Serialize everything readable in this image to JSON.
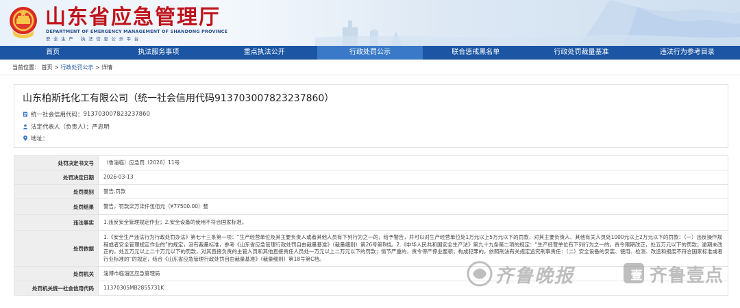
{
  "header": {
    "title": "山东省应急管理厅",
    "title_en": "DEPARTMENT OF EMERGENCY MANAGEMENT OF SHANDONG PROVINCE",
    "slogan": "安全生产 执法信息公示平台",
    "brand_color": "#c0141c",
    "nav_color": "#1b55a3"
  },
  "nav": {
    "items": [
      "首页",
      "执法服务事项",
      "重点执法公开",
      "行政处罚公示",
      "联合惩戒黑名单",
      "行政处罚裁量基准",
      "违法行为参考目录"
    ],
    "active_index": 3
  },
  "breadcrumb": {
    "prefix": "当前位置：",
    "home": "首页",
    "section": "行政处罚公示",
    "current": "详情",
    "sep": ">"
  },
  "company": {
    "title": "山东柏斯托化工有限公司（统一社会信用代码913703007823237860）",
    "credit_code_label": "统一社会信用代码：",
    "credit_code": "913703007823237860",
    "legal_rep_label": "法定代表人（负责人）：",
    "legal_rep": "严忠明",
    "address_label": "地址：",
    "address": ""
  },
  "penalty": {
    "rows": [
      {
        "label": "处罚决定书文号",
        "value": "（鲁淄临）应急罚〔2026〕11号"
      },
      {
        "label": "处罚决定日期",
        "value": "2026-03-13"
      },
      {
        "label": "处罚类别",
        "value": "警告,罚款"
      },
      {
        "label": "处罚结果",
        "value": "警告，罚款柒万柒仟伍佰元（¥77500.00）整"
      },
      {
        "label": "违法事实",
        "value": "1.违反安全管理规定作业；2.安全设备的使用不符合国家标准。"
      },
      {
        "label": "处罚依据",
        "value": "1.《安全生产违法行为行政处罚办法》第七十三条第一项：“生产经营单位及其主要负责人或者其他人员有下列行为之一的，给予警告，并可以对生产经营单位处1万元以上5万元以下的罚款，对其主要负责人、其他有关人员处1000元以上2万元以下的罚款：（一）违反操作规程或者安全管理规定作业的”的规定，没有裁量标准，参考《山东省应急管理行政处罚自由裁量基准》（裁量细则）第26号第B档。2.《中华人民共和国安全生产法》第九十九条第二项的规定：“生产经营单位有下列行为之一的，责令限期改正，处五万元以下的罚款；逾期未改正的，处五万元以上二十万元以下的罚款，对其直接负责的主管人员和其他直接责任人员处一万元以上二万元以下的罚款；情节严重的，责令停产停业整顿；构成犯罪的，依照刑法有关规定追究刑事责任：（二）安全设备的安装、使用、检测、改造和报废不符合国家标准或者行业标准的”的规定，结合《山东省应急管理行政处罚自由裁量基准》（裁量细则）第18号第C档。"
      },
      {
        "label": "处罚机关",
        "value": "淄博市临淄区应急管理局"
      },
      {
        "label": "处罚机关统一社会信用代码",
        "value": "11370305MB2855731K"
      }
    ]
  },
  "watermark": {
    "text1": "齐鲁晚报",
    "badge": "壹",
    "text2": "齐鲁壹点"
  },
  "icons": {
    "emblem": "national-emblem-icon",
    "credit": "document-icon",
    "person": "person-icon",
    "location": "location-pin-icon"
  }
}
